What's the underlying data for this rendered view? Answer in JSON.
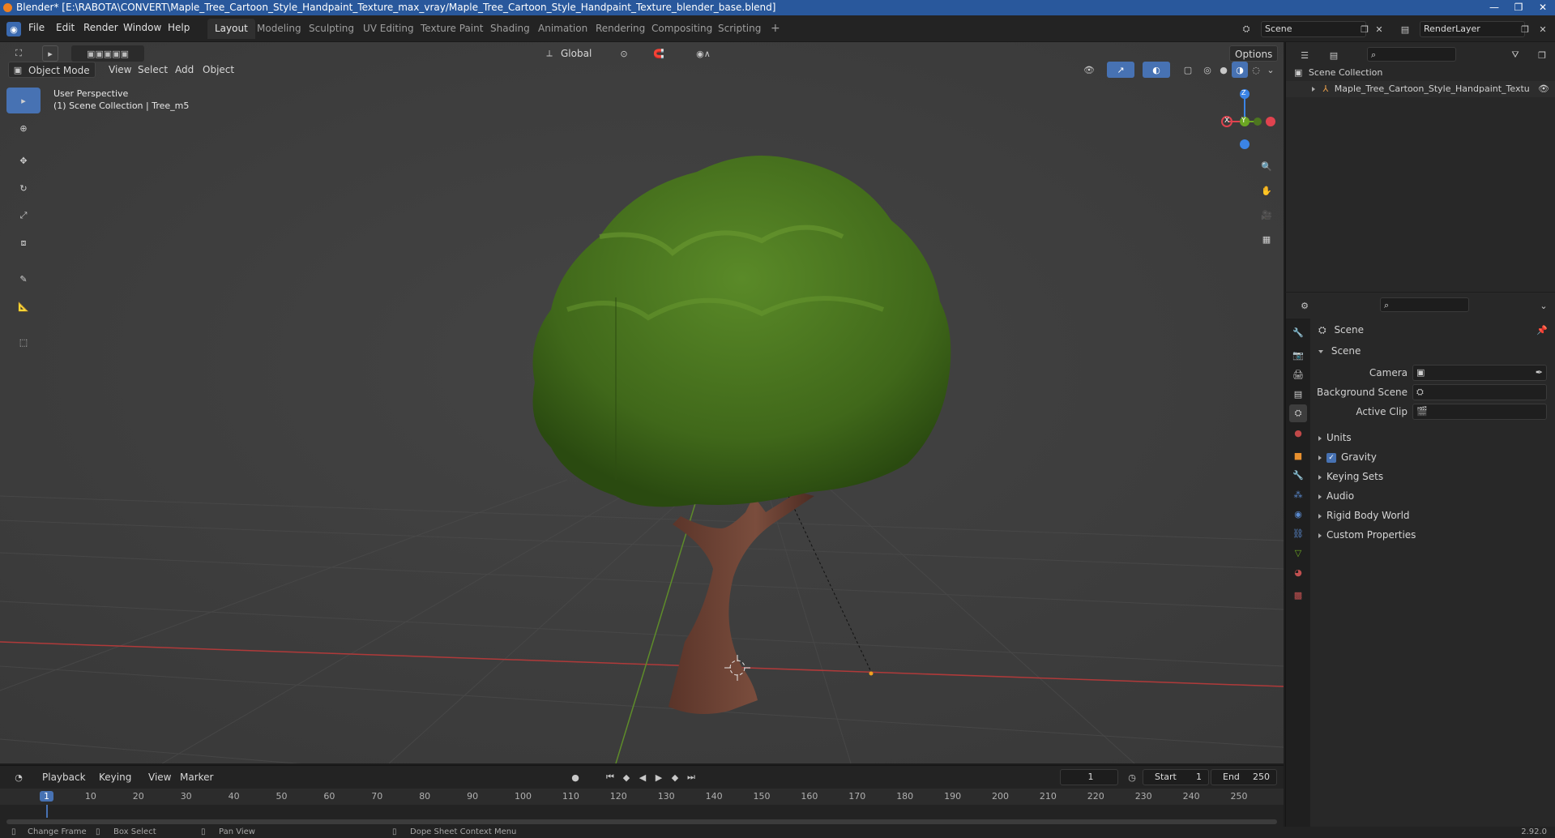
{
  "window": {
    "title": "Blender* [E:\\RABOTA\\CONVERT\\Maple_Tree_Cartoon_Style_Handpaint_Texture_max_vray/Maple_Tree_Cartoon_Style_Handpaint_Texture_blender_base.blend]"
  },
  "menu": [
    "File",
    "Edit",
    "Render",
    "Window",
    "Help"
  ],
  "workspaces": [
    "Layout",
    "Modeling",
    "Sculpting",
    "UV Editing",
    "Texture Paint",
    "Shading",
    "Animation",
    "Rendering",
    "Compositing",
    "Scripting"
  ],
  "active_workspace": "Layout",
  "scene_selector": {
    "value": "Scene"
  },
  "layer_selector": {
    "value": "RenderLayer"
  },
  "viewport_header": {
    "transform_orientation": "Global",
    "options_label": "Options",
    "mode": "Object Mode",
    "menus": [
      "View",
      "Select",
      "Add",
      "Object"
    ]
  },
  "viewport": {
    "perspective": "User Perspective",
    "collection_info": "(1) Scene Collection | Tree_m5",
    "gizmo_axes": {
      "x": "X",
      "y": "Y",
      "z": "Z"
    }
  },
  "colors": {
    "accent": "#4772b3",
    "axis_x": "#e0434f",
    "axis_y": "#6ba622",
    "axis_z": "#3b84e6",
    "foliage": "#4e7a1f",
    "trunk": "#6e4336"
  },
  "outliner": {
    "root": "Scene Collection",
    "items": [
      {
        "label": "Maple_Tree_Cartoon_Style_Handpaint_Textu"
      }
    ]
  },
  "properties": {
    "context": "Scene",
    "panel_title": "Scene",
    "fields": [
      {
        "label": "Camera"
      },
      {
        "label": "Background Scene"
      },
      {
        "label": "Active Clip"
      }
    ],
    "sections": [
      "Units",
      "Gravity",
      "Keying Sets",
      "Audio",
      "Rigid Body World",
      "Custom Properties"
    ],
    "gravity_checked": true
  },
  "timeline": {
    "menus": [
      "Playback",
      "Keying",
      "View",
      "Marker"
    ],
    "current_frame": "1",
    "start_label": "Start",
    "start_value": "1",
    "end_label": "End",
    "end_value": "250",
    "ruler": [
      "1",
      "10",
      "20",
      "30",
      "40",
      "50",
      "60",
      "70",
      "80",
      "90",
      "100",
      "110",
      "120",
      "130",
      "140",
      "150",
      "160",
      "170",
      "180",
      "190",
      "200",
      "210",
      "220",
      "230",
      "240",
      "250"
    ]
  },
  "statusbar": {
    "items": [
      "Change Frame",
      "Box Select",
      "Pan View",
      "Dope Sheet Context Menu"
    ],
    "version": "2.92.0"
  }
}
